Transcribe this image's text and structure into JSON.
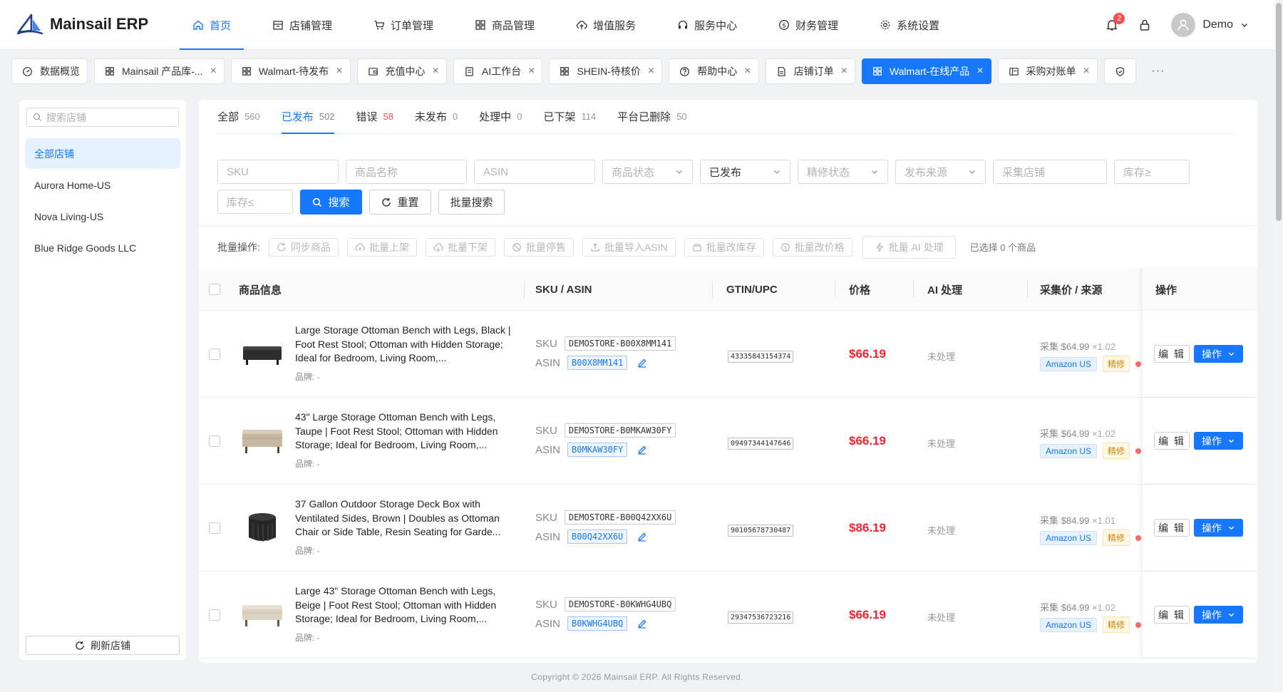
{
  "header": {
    "app_name": "Mainsail ERP",
    "nav": [
      "首页",
      "店铺管理",
      "订单管理",
      "商品管理",
      "增值服务",
      "服务中心",
      "财务管理",
      "系统设置"
    ],
    "notification_count": "2",
    "user_name": "Demo"
  },
  "tabs": [
    {
      "label": "数据概览",
      "icon": "dashboard-icon",
      "closable": false
    },
    {
      "label": "Mainsail 产品库-...",
      "icon": "grid-icon",
      "closable": true
    },
    {
      "label": "Walmart-待发布",
      "icon": "grid-icon",
      "closable": true
    },
    {
      "label": "充值中心",
      "icon": "wallet-icon",
      "closable": true
    },
    {
      "label": "AI工作台",
      "icon": "ai-icon",
      "closable": true
    },
    {
      "label": "SHEIN-待核价",
      "icon": "grid-icon",
      "closable": true
    },
    {
      "label": "帮助中心",
      "icon": "help-icon",
      "closable": true
    },
    {
      "label": "店铺订单",
      "icon": "doc-icon",
      "closable": true
    },
    {
      "label": "Walmart-在线产品",
      "icon": "grid-icon",
      "closable": true
    },
    {
      "label": "采购对账单",
      "icon": "ledger-icon",
      "closable": true
    }
  ],
  "tabs_more": "···",
  "sidebar": {
    "search_placeholder": "搜索店铺",
    "stores": [
      "全部店铺",
      "Aurora Home-US",
      "Nova Living-US",
      "Blue Ridge Goods LLC"
    ],
    "refresh_label": "刷新店铺"
  },
  "status_tabs": [
    {
      "label": "全部",
      "count": "560"
    },
    {
      "label": "已发布",
      "count": "502"
    },
    {
      "label": "错误",
      "count": "58"
    },
    {
      "label": "未发布",
      "count": "0"
    },
    {
      "label": "处理中",
      "count": "0"
    },
    {
      "label": "已下架",
      "count": "114"
    },
    {
      "label": "平台已删除",
      "count": "50"
    }
  ],
  "filters": {
    "sku": "SKU",
    "name": "商品名称",
    "asin": "ASIN",
    "product_status": "商品状态",
    "published": "已发布",
    "refine_status": "精修状态",
    "source": "发布来源",
    "collect_store": "采集店铺",
    "stock_min": "库存≥",
    "stock_max": "库存≤",
    "search_btn": "搜索",
    "reset_btn": "重置",
    "batch_search_btn": "批量搜索"
  },
  "batch": {
    "label": "批量操作:",
    "actions": [
      "同步商品",
      "批量上架",
      "批量下架",
      "批量停售",
      "批量导入ASIN",
      "批量改库存",
      "批量改价格"
    ],
    "ai_action": "批量 AI 处理",
    "selected": "已选择 0 个商品"
  },
  "columns": [
    "商品信息",
    "SKU / ASIN",
    "GTIN/UPC",
    "价格",
    "AI 处理",
    "采集价 / 来源",
    "操作"
  ],
  "row_labels": {
    "brand": "品牌: -",
    "sku": "SKU",
    "asin": "ASIN",
    "edit": "编 辑",
    "op": "操作",
    "cost_prefix": "采集",
    "source_tag": "Amazon US",
    "refine_tag": "精修"
  },
  "rows": [
    {
      "title": "Large Storage Ottoman Bench with Legs, Black | Foot Rest Stool; Ottoman with Hidden Storage; Ideal for Bedroom, Living Room,...",
      "sku": "DEMOSTORE-B00X8MM141",
      "asin": "B00X8MM141",
      "gtin": "43335843154374",
      "price": "$66.19",
      "ai": "未处理",
      "cost": "$64.99",
      "mult": "×1.02",
      "img": "black-bench"
    },
    {
      "title": "43\" Large Storage Ottoman Bench with Legs, Taupe | Foot Rest Stool; Ottoman with Hidden Storage; Ideal for Bedroom, Living Room,...",
      "sku": "DEMOSTORE-B0MKAW30FY",
      "asin": "B0MKAW30FY",
      "gtin": "09497344147646",
      "price": "$66.19",
      "ai": "未处理",
      "cost": "$64.99",
      "mult": "×1.02",
      "img": "taupe-bench"
    },
    {
      "title": "37 Gallon Outdoor Storage Deck Box with Ventilated Sides, Brown | Doubles as Ottoman Chair or Side Table, Resin Seating for Garde...",
      "sku": "DEMOSTORE-B00Q42XX6U",
      "asin": "B00Q42XX6U",
      "gtin": "90105678730487",
      "price": "$86.19",
      "ai": "未处理",
      "cost": "$84.99",
      "mult": "×1.01",
      "img": "deck-box"
    },
    {
      "title": "Large 43\" Storage Ottoman Bench with Legs, Beige | Foot Rest Stool; Ottoman with Hidden Storage; Ideal for Bedroom, Living Room,...",
      "sku": "DEMOSTORE-B0KWHG4UBQ",
      "asin": "B0KWHG4UBQ",
      "gtin": "29347536723216",
      "price": "$66.19",
      "ai": "未处理",
      "cost": "$64.99",
      "mult": "×1.02",
      "img": "beige-bench"
    }
  ],
  "footer": "Copyright © 2026 Mainsail ERP. All Rights Reserved.",
  "colors": {
    "primary": "#1677ff",
    "price": "#f5222d",
    "refine": "#d48806"
  }
}
